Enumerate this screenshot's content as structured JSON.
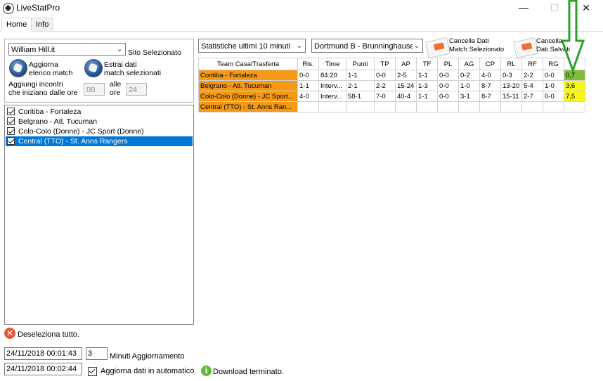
{
  "window": {
    "title": "LiveStatPro"
  },
  "tabs": [
    {
      "label": "Home"
    },
    {
      "label": "Info"
    }
  ],
  "left": {
    "site_select": "William Hill.it",
    "site_label": "Sito Selezionato",
    "update_btn": {
      "line1": "Aggiorna",
      "line2": "elenco match"
    },
    "extract_btn": {
      "line1": "Estrai dati",
      "line2": "match selezionati"
    },
    "add_label": {
      "line1": "Aggiungi incontri",
      "line2": "che iniziano dalle ore"
    },
    "from_hour": "00",
    "to_label": {
      "line1": "alle",
      "line2": "ore"
    },
    "to_hour": "24",
    "matches": [
      {
        "name": "Coritiba  - Fortaleza",
        "checked": true,
        "selected": false
      },
      {
        "name": "Belgrano  - Atl. Tucuman",
        "checked": true,
        "selected": false
      },
      {
        "name": "Colo-Colo (Donne)  - JC Sport (Donne)",
        "checked": true,
        "selected": false
      },
      {
        "name": "Central (TTO)  - St. Anns Rangers",
        "checked": true,
        "selected": true
      }
    ],
    "deselect_all": "Deseleziona tutto.",
    "datetime1": "24/11/2018 00:01:43",
    "datetime2": "24/11/2018 00:02:44",
    "minutes_value": "3",
    "minutes_label": "Minuti Aggiornamento",
    "auto_update_label": "Aggiorna dati  in automatico",
    "auto_update_checked": true,
    "status": "Download terminato."
  },
  "right": {
    "stats_select": "Statistiche ultimi 10 minuti",
    "match_select": "Dortmund B - Brunninghausen",
    "delete_selected": {
      "line1": "Cancella Dati",
      "line2": "Match Selezionato"
    },
    "delete_saved": {
      "line1": "Cancella",
      "line2": "Dati Salvati"
    },
    "columns": [
      "Team Casa/Trasferta",
      "Ris.",
      "Time",
      "Punti",
      "TP",
      "AP",
      "TF",
      "PL",
      "AG",
      "CP",
      "RL",
      "RF",
      "RG",
      ""
    ],
    "rows": [
      [
        "Coritiba - Fortaleza",
        "0-0",
        "84:20",
        "1-1",
        "0-0",
        "2-5",
        "1-1",
        "0-0",
        "0-2",
        "4-0",
        "0-3",
        "2-2",
        "0-0",
        "0,7"
      ],
      [
        "Belgrano - Atl. Tucuman",
        "1-1",
        "Interv...",
        "2-1",
        "2-2",
        "15-24",
        "1-3",
        "0-0",
        "1-0",
        "8-7",
        "13-20",
        "5-4",
        "1-0",
        "3,6"
      ],
      [
        "Colo-Colo (Donne) - JC Sport...",
        "4-0",
        "Interv...",
        "58-1",
        "7-0",
        "40-4",
        "1-1",
        "0-0",
        "3-1",
        "8-7",
        "15-11",
        "2-7",
        "0-0",
        "7,5"
      ],
      [
        "Central (TTO) - St. Anns Ran...",
        "",
        "",
        "",
        "",
        "",
        "",
        "",
        "",
        "",
        "",
        "",
        "",
        ""
      ]
    ],
    "last_col_colors": [
      "#7dbf3a",
      "#f7f71a",
      "#f7f71a",
      ""
    ],
    "annotation_color": "#2ca02c"
  }
}
